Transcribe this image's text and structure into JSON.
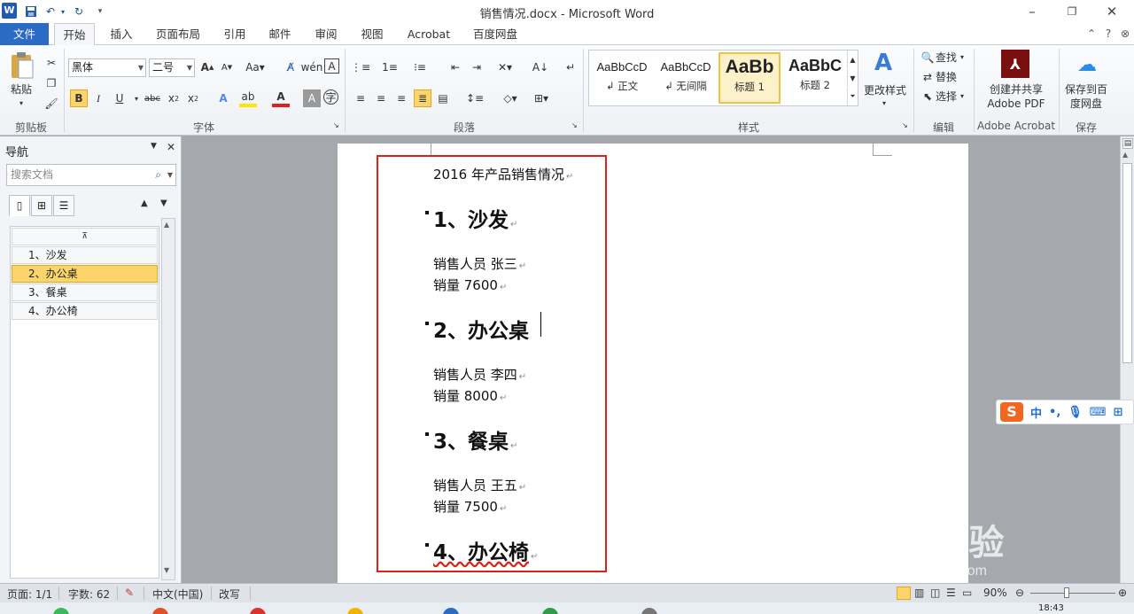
{
  "window": {
    "title": "销售情况.docx  -  Microsoft Word"
  },
  "quick_access": {
    "app_icon": "W",
    "save": "save-icon",
    "undo": "undo-icon",
    "redo": "redo-icon"
  },
  "tabs": [
    "文件",
    "开始",
    "插入",
    "页面布局",
    "引用",
    "邮件",
    "审阅",
    "视图",
    "Acrobat",
    "百度网盘"
  ],
  "ribbon": {
    "clipboard": {
      "paste_label": "粘贴",
      "group_label": "剪贴板"
    },
    "font": {
      "font_name": "黑体",
      "font_size": "二号",
      "group_label": "字体"
    },
    "paragraph": {
      "group_label": "段落"
    },
    "styles": {
      "group_label": "样式",
      "items": [
        {
          "sample": "AaBbCcD",
          "name": "↲ 正文"
        },
        {
          "sample": "AaBbCcD",
          "name": "↲ 无间隔"
        },
        {
          "sample": "AaBb",
          "name": "标题 1"
        },
        {
          "sample": "AaBbC",
          "name": "标题 2"
        }
      ],
      "change_styles": "更改样式"
    },
    "editing": {
      "find": "查找",
      "replace": "替换",
      "select": "选择",
      "group_label": "编辑"
    },
    "acrobat": {
      "create_pdf_line1": "创建并共享",
      "create_pdf_line2": "Adobe PDF",
      "group_label": "Adobe Acrobat"
    },
    "save_group": {
      "save_line1": "保存到百",
      "save_line2": "度网盘",
      "group_label": "保存"
    }
  },
  "nav_pane": {
    "title": "导航",
    "search_placeholder": "搜索文档",
    "items": [
      "1、沙发",
      "2、办公桌",
      "3、餐桌",
      "4、办公椅"
    ],
    "selected_index": 1
  },
  "document": {
    "title": "2016 年产品销售情况",
    "sections": [
      {
        "heading": "1、沙发",
        "person": "销售人员 张三",
        "amount": "销量 7600"
      },
      {
        "heading": "2、办公桌",
        "person": "销售人员 李四",
        "amount": "销量 8000"
      },
      {
        "heading": "3、餐桌",
        "person": "销售人员 王五",
        "amount": "销量 7500"
      },
      {
        "heading": "4、办公椅"
      }
    ]
  },
  "ime": {
    "logo": "S",
    "mode": "中",
    "punct": "•,"
  },
  "watermark": {
    "brand": "Bai 经验",
    "url": "jingyan.baidu.com"
  },
  "statusbar": {
    "page": "页面: 1/1",
    "words": "字数: 62",
    "language": "中文(中国)",
    "mode": "改写",
    "zoom": "90%"
  },
  "taskbar": {
    "clock": "18:43"
  },
  "colors": {
    "file_tab": "#2b6bc4",
    "highlight_box": "#e0201b",
    "nav_selected": "#fcd56a"
  }
}
